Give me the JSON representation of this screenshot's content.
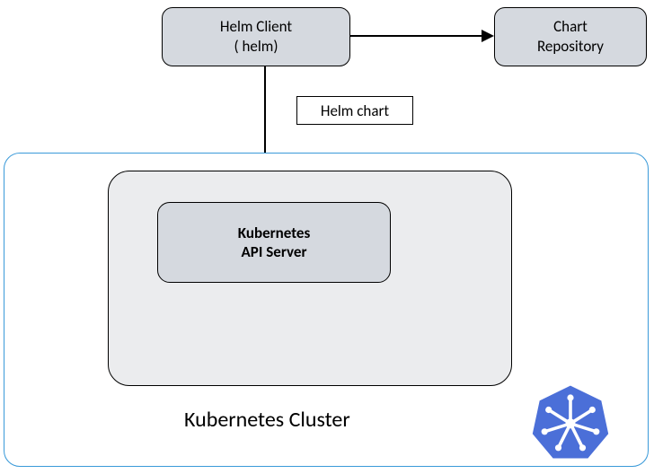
{
  "helm_client": {
    "line1": "Helm Client",
    "line2": "( helm)"
  },
  "chart_repo": {
    "line1": "Chart",
    "line2": "Repository"
  },
  "helm_chart_label": "Helm chart",
  "api_server": {
    "line1": "Kubernetes",
    "line2": "API Server"
  },
  "cluster_label": "Kubernetes Cluster",
  "logo_name": "kubernetes-logo"
}
